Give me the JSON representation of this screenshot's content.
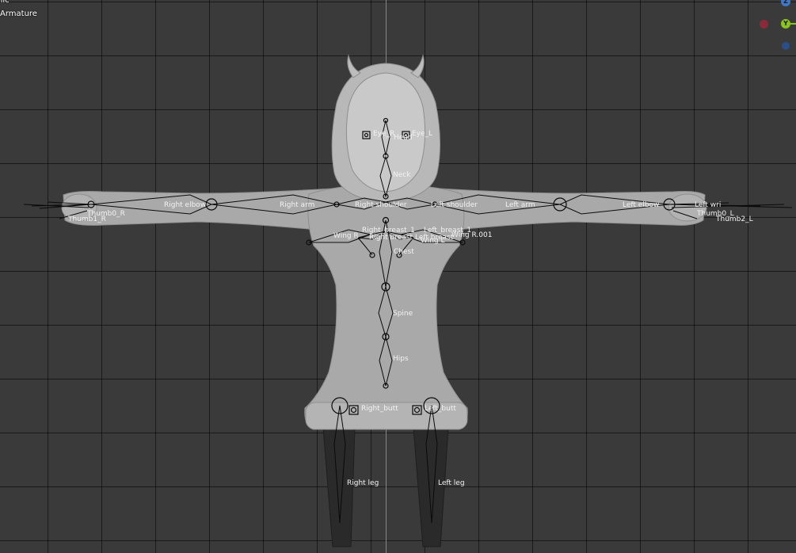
{
  "header": {
    "view_mode": "nic",
    "object_name": "Armature"
  },
  "gizmo": {
    "axis_z_label": "Z",
    "axis_y_label": "Y",
    "x_color": "#c8324a",
    "y_color": "#8bc41e",
    "z_color": "#3e78c8",
    "neg_x_color": "#8a2a38",
    "neg_z_color": "#2a4f86"
  },
  "bones": {
    "head": "Head",
    "eye_r": "Eye_R",
    "eye_l": "Eye_L",
    "neck": "Neck",
    "right_elbow": "Right elbow",
    "right_arm": "Right arm",
    "right_shoulder": "Right shoulder",
    "left_shoulder": "Left shoulder",
    "left_arm": "Left arm",
    "left_elbow": "Left elbow",
    "left_wrist": "Left wri",
    "right_breast_1": "Right_breast_1",
    "left_breast_1": "Left_breast_1",
    "wing_r": "Wing R",
    "right_breast": "Right breast",
    "left_breast": "Left breast",
    "wing_r_001": "Wing R.001",
    "wing_l": "Wing L",
    "chest": "Chest",
    "spine": "Spine",
    "hips": "Hips",
    "right_butt": "Right_butt",
    "left_butt": "Left_butt",
    "right_leg": "Right leg",
    "left_leg": "Left leg",
    "thumb0_r": "Thumb0_R",
    "thumb1_r": "Thumb1_R",
    "thumb0_l": "Thumb0_L",
    "thumb2_l": "Thumb2_L"
  }
}
